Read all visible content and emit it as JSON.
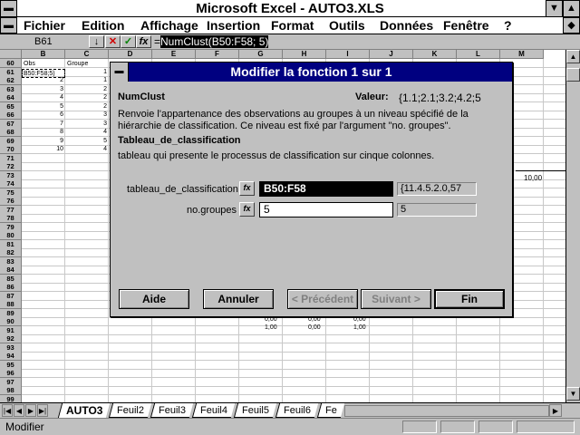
{
  "window": {
    "title": "Microsoft Excel - AUTO3.XLS"
  },
  "menu": [
    "Fichier",
    "Edition",
    "Affichage",
    "Insertion",
    "Format",
    "Outils",
    "Données",
    "Fenêtre",
    "?"
  ],
  "formula_bar": {
    "cell_ref": "B61",
    "formula_prefix": "=",
    "formula_highlight": "NumClust(B50:F58; 5)"
  },
  "grid": {
    "columns": [
      "B",
      "C",
      "D",
      "E",
      "F",
      "G",
      "H",
      "I",
      "J",
      "K",
      "L",
      "M"
    ],
    "rows": [
      "60",
      "61",
      "62",
      "63",
      "64",
      "65",
      "66",
      "67",
      "68",
      "69",
      "70",
      "71",
      "72",
      "73",
      "74",
      "75",
      "76",
      "77",
      "78",
      "79",
      "80",
      "81",
      "82",
      "83",
      "84",
      "85",
      "86",
      "87",
      "88",
      "89",
      "90",
      "91",
      "92",
      "93",
      "94",
      "95",
      "96",
      "97",
      "98",
      "99"
    ],
    "header_obs": "Obs",
    "header_groupe": "Groupe",
    "active_cell_text": "B50:F58;5)",
    "obs": [
      "2",
      "3",
      "4",
      "5",
      "6",
      "7",
      "8",
      "9",
      "10"
    ],
    "groupe": [
      "1",
      "1",
      "2",
      "2",
      "2",
      "3",
      "3",
      "4",
      "5",
      "4"
    ],
    "chart_label": "10,00",
    "row88": [
      "0,00",
      "0,00",
      "0,00"
    ],
    "row89": [
      "1,00",
      "0,00",
      "1,00"
    ]
  },
  "dialog": {
    "title": "Modifier la fonction 1 sur 1",
    "function_name": "NumClust",
    "value_label": "Valeur:",
    "value": "{1.1;2.1;3.2;4.2;5",
    "description_line1": "Renvoie l'appartenance des observations au groupes à un niveau spécifié de la",
    "description_line2": "hiérarchie de classification. Ce niveau est fixé par l'argument \"no. groupes\".",
    "arg_title": "Tableau_de_classification",
    "arg_description": "tableau qui presente le processus de classification sur cinque colonnes.",
    "args": [
      {
        "label": "tableau_de_classification",
        "value": "B50:F58",
        "result": "{11.4.5.2.0,57"
      },
      {
        "label": "no.groupes",
        "value": "5",
        "result": "5"
      }
    ],
    "buttons": {
      "help": "Aide",
      "cancel": "Annuler",
      "previous": "< Précédent",
      "next": "Suivant >",
      "finish": "Fin"
    }
  },
  "sheets": [
    "AUTO3",
    "Feuil2",
    "Feuil3",
    "Feuil4",
    "Feuil5",
    "Feuil6",
    "Fe"
  ],
  "status": {
    "mode": "Modifier"
  }
}
